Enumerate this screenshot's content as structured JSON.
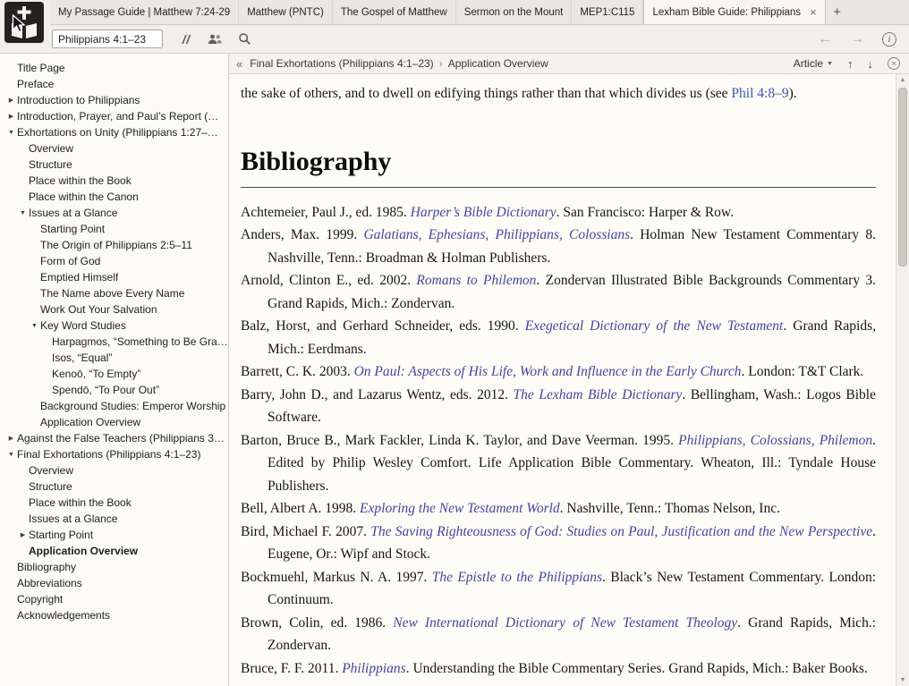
{
  "colors": {
    "link_title": "#4444a4",
    "link_ref": "#3b57b5"
  },
  "icons": {
    "collapsed": "▶",
    "expanded": "▼",
    "close": "×",
    "back": "←",
    "forward": "→",
    "collapse_panel": "«",
    "crumb_separator": "›",
    "dropdown": "▼",
    "up": "↑",
    "down": "↓",
    "scroll_up": "▲",
    "scroll_down": "▼"
  },
  "tabs": {
    "new_tab_label": "+",
    "items": [
      {
        "label": "My Passage Guide | Matthew 7:24-29",
        "active": false
      },
      {
        "label": "Matthew (PNTC)",
        "active": false
      },
      {
        "label": "The Gospel of Matthew",
        "active": false
      },
      {
        "label": "Sermon on the Mount",
        "active": false
      },
      {
        "label": "MEP1:C115",
        "active": false
      },
      {
        "label": "Lexham Bible Guide: Philippians",
        "active": true,
        "closable": true
      }
    ]
  },
  "toolbar": {
    "reference_value": "Philippians 4:1–23"
  },
  "sidebar": {
    "items": [
      {
        "label": "Title Page",
        "level": 0,
        "state": "leaf"
      },
      {
        "label": "Preface",
        "level": 0,
        "state": "leaf"
      },
      {
        "label": "Introduction to Philippians",
        "level": 0,
        "state": "collapsed"
      },
      {
        "label": "Introduction, Prayer, and Paul’s Report (…",
        "level": 0,
        "state": "collapsed"
      },
      {
        "label": "Exhortations on Unity (Philippians 1:27–…",
        "level": 0,
        "state": "expanded"
      },
      {
        "label": "Overview",
        "level": 1,
        "state": "leaf"
      },
      {
        "label": "Structure",
        "level": 1,
        "state": "leaf"
      },
      {
        "label": "Place within the Book",
        "level": 1,
        "state": "leaf"
      },
      {
        "label": "Place within the Canon",
        "level": 1,
        "state": "leaf"
      },
      {
        "label": "Issues at a Glance",
        "level": 1,
        "state": "expanded"
      },
      {
        "label": "Starting Point",
        "level": 2,
        "state": "leaf"
      },
      {
        "label": "The Origin of Philippians 2:5–11",
        "level": 2,
        "state": "leaf"
      },
      {
        "label": "Form of God",
        "level": 2,
        "state": "leaf"
      },
      {
        "label": "Emptied Himself",
        "level": 2,
        "state": "leaf"
      },
      {
        "label": "The Name above Every Name",
        "level": 2,
        "state": "leaf"
      },
      {
        "label": "Work Out Your Salvation",
        "level": 2,
        "state": "leaf"
      },
      {
        "label": "Key Word Studies",
        "level": 2,
        "state": "expanded"
      },
      {
        "label": "Harpagmos, “Something to Be Gra…",
        "level": 3,
        "state": "leaf"
      },
      {
        "label": "Isos, “Equal”",
        "level": 3,
        "state": "leaf"
      },
      {
        "label": "Kenoō, “To Empty”",
        "level": 3,
        "state": "leaf"
      },
      {
        "label": "Spendō, “To Pour Out”",
        "level": 3,
        "state": "leaf"
      },
      {
        "label": "Background Studies: Emperor Worship",
        "level": 2,
        "state": "leaf"
      },
      {
        "label": "Application Overview",
        "level": 2,
        "state": "leaf"
      },
      {
        "label": "Against the False Teachers (Philippians 3…",
        "level": 0,
        "state": "collapsed"
      },
      {
        "label": "Final Exhortations (Philippians 4:1–23)",
        "level": 0,
        "state": "expanded"
      },
      {
        "label": "Overview",
        "level": 1,
        "state": "leaf"
      },
      {
        "label": "Structure",
        "level": 1,
        "state": "leaf"
      },
      {
        "label": "Place within the Book",
        "level": 1,
        "state": "leaf"
      },
      {
        "label": "Issues at a Glance",
        "level": 1,
        "state": "leaf"
      },
      {
        "label": "Starting Point",
        "level": 1,
        "state": "collapsed"
      },
      {
        "label": "Application Overview",
        "level": 1,
        "state": "leaf",
        "current": true
      },
      {
        "label": "Bibliography",
        "level": 0,
        "state": "leaf"
      },
      {
        "label": "Abbreviations",
        "level": 0,
        "state": "leaf"
      },
      {
        "label": "Copyright",
        "level": 0,
        "state": "leaf"
      },
      {
        "label": "Acknowledgements",
        "level": 0,
        "state": "leaf"
      }
    ]
  },
  "content_header": {
    "breadcrumb": [
      {
        "label": "Final Exhortations (Philippians 4:1–23)"
      },
      {
        "label": "Application Overview"
      }
    ],
    "article_dropdown": "Article"
  },
  "article": {
    "lead_paragraph": {
      "before": "the sake of others, and to dwell on edifying things rather than that which divides us (see ",
      "link": "Phil 4:8–9",
      "after": ")."
    },
    "heading": "Bibliography",
    "bibliography": [
      {
        "citation": "Achtemeier, Paul J., ed. 1985. ",
        "title": "Harper’s Bible Dictionary",
        "rest": ". San Francisco: Harper & Row."
      },
      {
        "citation": "Anders, Max. 1999. ",
        "title": "Galatians, Ephesians, Philippians, Colossians",
        "rest": ". Holman New Testament Commentary 8. Nashville, Tenn.: Broadman & Holman Publishers."
      },
      {
        "citation": "Arnold, Clinton E., ed. 2002. ",
        "title": "Romans to Philemon",
        "rest": ". Zondervan Illustrated Bible Backgrounds Commentary 3. Grand Rapids, Mich.: Zondervan."
      },
      {
        "citation": "Balz, Horst, and Gerhard Schneider, eds. 1990. ",
        "title": "Exegetical Dictionary of the New Testament",
        "rest": ". Grand Rapids, Mich.: Eerdmans."
      },
      {
        "citation": "Barrett, C. K. 2003. ",
        "title": "On Paul: Aspects of His Life, Work and Influence in the Early Church",
        "rest": ". London: T&T Clark."
      },
      {
        "citation": "Barry, John D., and Lazarus Wentz, eds. 2012. ",
        "title": "The Lexham Bible Dictionary",
        "rest": ". Bellingham, Wash.: Logos Bible Software."
      },
      {
        "citation": "Barton, Bruce B., Mark Fackler, Linda K. Taylor, and Dave Veerman. 1995. ",
        "title": "Philippians, Colossians, Philemon",
        "rest": ". Edited by Philip Wesley Comfort. Life Application Bible Commentary. Wheaton, Ill.: Tyndale House Publishers."
      },
      {
        "citation": "Bell, Albert A. 1998. ",
        "title": "Exploring the New Testament World",
        "rest": ". Nashville, Tenn.: Thomas Nelson, Inc."
      },
      {
        "citation": "Bird, Michael F. 2007. ",
        "title": "The Saving Righteousness of God: Studies on Paul, Justification and the New Perspective",
        "rest": ". Eugene, Or.: Wipf and Stock."
      },
      {
        "citation": "Bockmuehl, Markus N. A. 1997. ",
        "title": "The Epistle to the Philippians",
        "rest": ". Black’s New Testament Commentary. London: Continuum."
      },
      {
        "citation": "Brown, Colin, ed. 1986. ",
        "title": "New International Dictionary of New Testament Theology",
        "rest": ". Grand Rapids, Mich.: Zondervan."
      },
      {
        "citation": "Bruce, F. F. 2011. ",
        "title": "Philippians",
        "rest": ". Understanding the Bible Commentary Series. Grand Rapids, Mich.: Baker Books."
      }
    ]
  }
}
